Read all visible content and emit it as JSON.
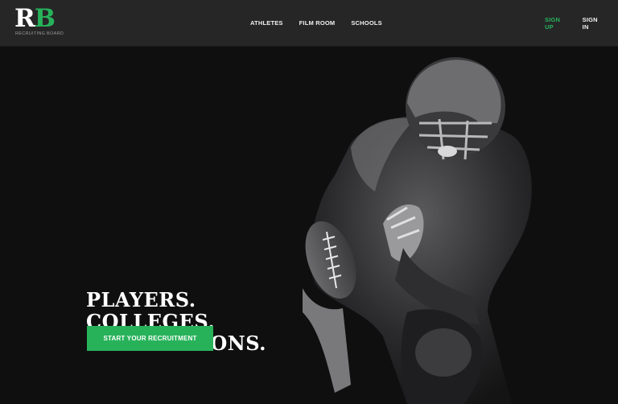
{
  "logo": {
    "mark_r": "R",
    "mark_b": "B",
    "subtitle": "RECRUITING BOARD"
  },
  "nav": {
    "items": [
      {
        "label": "ATHLETES"
      },
      {
        "label": "FILM ROOM"
      },
      {
        "label": "SCHOOLS"
      }
    ],
    "sign_up": "SIGN UP",
    "sign_in": "SIGN IN"
  },
  "hero": {
    "headline": [
      "PLAYERS.",
      "COLLEGES.",
      "CONNECTIONS."
    ],
    "cta_label": "START YOUR RECRUITMENT",
    "image": "football-player-crouching-with-ball"
  },
  "colors": {
    "accent": "#27b25a",
    "nav_bg": "#262627",
    "hero_bg": "#0f0f10",
    "text": "#ffffff"
  }
}
